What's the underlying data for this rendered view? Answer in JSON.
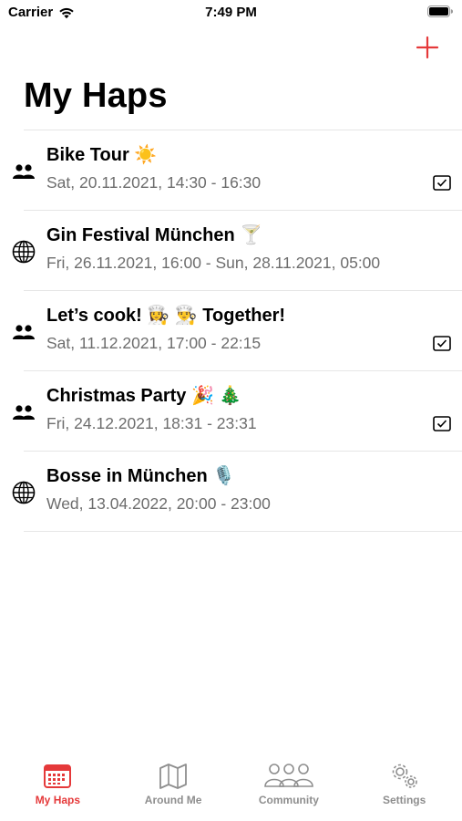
{
  "status_bar": {
    "carrier": "Carrier",
    "time": "7:49 PM"
  },
  "header": {
    "title": "My Haps",
    "add_icon": "plus-icon"
  },
  "colors": {
    "accent": "#e5393a",
    "separator": "#e6e6e6",
    "secondary_text": "#6d6d6d",
    "inactive_tab": "#8e8e8e"
  },
  "haps": [
    {
      "title": "Bike Tour ☀️",
      "subtitle": "Sat, 20.11.2021, 14:30 - 16:30",
      "type_icon": "group-icon",
      "checked": true
    },
    {
      "title": "Gin Festival München 🍸",
      "subtitle": "Fri, 26.11.2021, 16:00 - Sun, 28.11.2021, 05:00",
      "type_icon": "globe-icon",
      "checked": false
    },
    {
      "title": "Let’s cook! 👩‍🍳 👨‍🍳 Together!",
      "subtitle": "Sat, 11.12.2021, 17:00 - 22:15",
      "type_icon": "group-icon",
      "checked": true
    },
    {
      "title": "Christmas Party 🎉 🎄",
      "subtitle": "Fri, 24.12.2021, 18:31 - 23:31",
      "type_icon": "group-icon",
      "checked": true
    },
    {
      "title": "Bosse in München 🎙️",
      "subtitle": "Wed, 13.04.2022, 20:00 - 23:00",
      "type_icon": "globe-icon",
      "checked": false
    }
  ],
  "tab_bar": {
    "tabs": [
      {
        "label": "My Haps",
        "icon": "calendar-icon",
        "active": true
      },
      {
        "label": "Around Me",
        "icon": "map-icon",
        "active": false
      },
      {
        "label": "Community",
        "icon": "community-icon",
        "active": false
      },
      {
        "label": "Settings",
        "icon": "gears-icon",
        "active": false
      }
    ]
  }
}
